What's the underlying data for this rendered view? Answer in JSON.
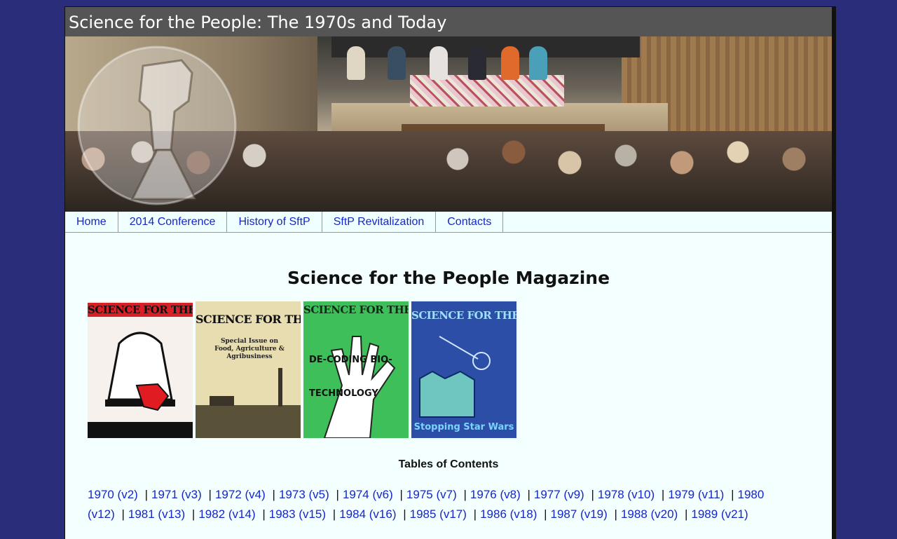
{
  "site": {
    "title": "Science for the People: The 1970s and Today"
  },
  "nav": [
    {
      "label": "Home"
    },
    {
      "label": "2014 Conference"
    },
    {
      "label": "History of SftP"
    },
    {
      "label": "SftP Revitalization"
    },
    {
      "label": "Contacts"
    }
  ],
  "main": {
    "heading": "Science for the People Magazine",
    "covers": [
      {
        "masthead": "SCIENCE FOR THE PEOPLE",
        "subtitle": ""
      },
      {
        "masthead": "SCIENCE FOR THE PEOPLE",
        "subtitle": "Special Issue on Food, Agriculture & Agribusiness"
      },
      {
        "masthead": "SCIENCE FOR THE PEOPLE",
        "subtitle": "DE-CODING BIO-TECHNOLOGY"
      },
      {
        "masthead": "SCIENCE FOR THE PEOPLE",
        "subtitle": "Stopping Star Wars"
      }
    ],
    "toc_heading": "Tables of Contents",
    "toc_links": [
      "1970 (v2)",
      "1971 (v3)",
      "1972 (v4)",
      "1973 (v5)",
      "1974 (v6)",
      "1975 (v7)",
      "1976 (v8)",
      "1977 (v9)",
      "1978 (v10)",
      "1979 (v11)",
      "1980 (v12)",
      "1981 (v13)",
      "1982 (v14)",
      "1983 (v15)",
      "1984 (v16)",
      "1985 (v17)",
      "1986 (v18)",
      "1987 (v19)",
      "1988 (v20)",
      "1989 (v21)"
    ]
  },
  "colors": {
    "background": "#2a2e7a",
    "link": "#1526c8",
    "titlebar": "#555555"
  }
}
